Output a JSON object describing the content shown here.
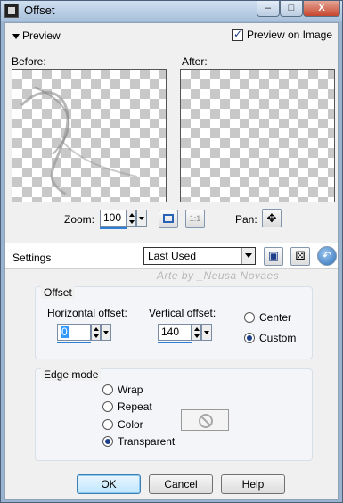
{
  "window": {
    "title": "Offset",
    "buttons": {
      "minimize": "–",
      "maximize": "□",
      "close": "X"
    }
  },
  "preview": {
    "toggle_label": "Preview",
    "preview_on_image_label": "Preview on Image",
    "preview_on_image_checked": true,
    "before_label": "Before:",
    "after_label": "After:"
  },
  "zoom": {
    "label": "Zoom:",
    "value": "100",
    "fit_icon": "zoom-fit-icon",
    "actual_size_label": "1:1",
    "pan_label": "Pan:",
    "pan_icon": "move-arrows-icon"
  },
  "settings": {
    "label": "Settings",
    "preset_value": "Last Used",
    "save_icon": "floppy-disk-icon",
    "randomize_icon": "dice-icon",
    "reset_icon": "reset-arrow-icon",
    "watermark": "Arte by _Neusa Novaes"
  },
  "offset": {
    "group_title": "Offset",
    "horizontal_label": "Horizontal offset:",
    "horizontal_value": "0",
    "vertical_label": "Vertical offset:",
    "vertical_value": "140",
    "center_label": "Center",
    "custom_label": "Custom",
    "selected": "Custom"
  },
  "edge_mode": {
    "group_title": "Edge mode",
    "options": [
      "Wrap",
      "Repeat",
      "Color",
      "Transparent"
    ],
    "selected": "Transparent",
    "color_swatch_icon": "disabled-circle-icon"
  },
  "buttons": {
    "ok": "OK",
    "cancel": "Cancel",
    "help": "Help"
  },
  "colors": {
    "titlebar": "#a9c1dc",
    "accent": "#2f7fd6",
    "checker": "#c8c8c8"
  }
}
